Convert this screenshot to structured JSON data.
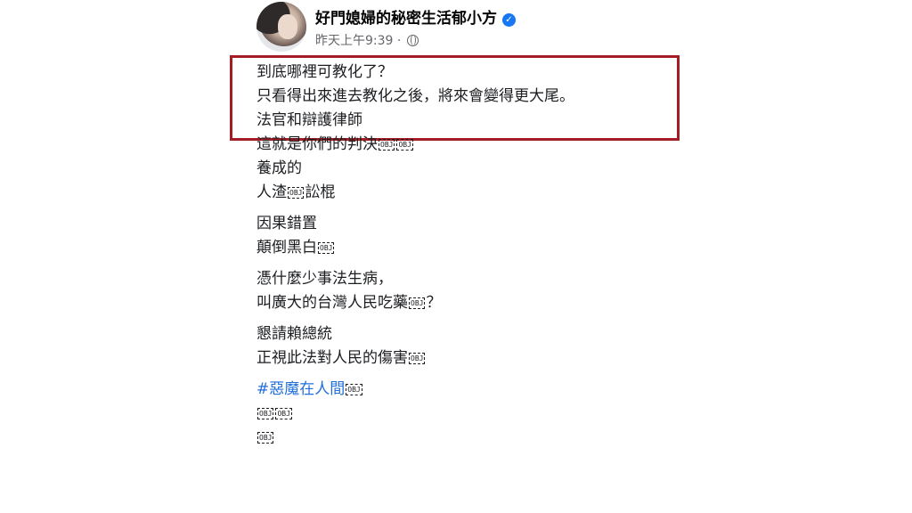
{
  "post": {
    "author_name": "好門媳婦的秘密生活郁小方",
    "verified_glyph": "✓",
    "timestamp": "昨天上午9:39",
    "separator": "·",
    "privacy_icon": "globe-icon",
    "highlight_color": "#a51d24"
  },
  "lines": {
    "l1": "到底哪裡可教化了？",
    "l2": "只看得出來進去教化之後，將來會變得更大尾。",
    "l3": "法官和辯護律師",
    "l4": "這就是你們的判決",
    "l5": "養成的",
    "l6a": "人渣",
    "l6b": "訟棍",
    "l7": "因果錯置",
    "l8": "顛倒黑白",
    "l9": "憑什麼少事法生病，",
    "l10a": "叫廣大的台灣人民吃藥",
    "l10b": "？",
    "l11": "懇請賴總統",
    "l12": "正視此法對人民的傷害",
    "hashtag": "#惡魔在人間",
    "obj": "OBJ"
  }
}
